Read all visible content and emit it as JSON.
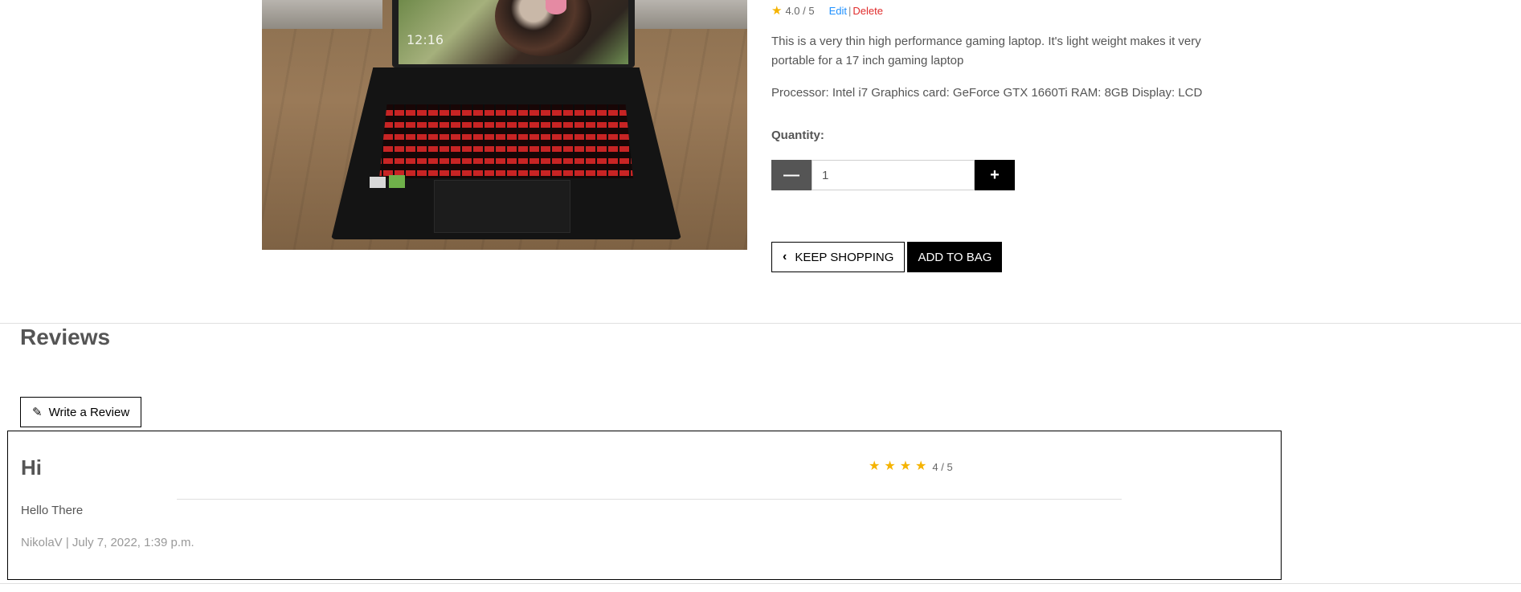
{
  "product": {
    "rating_text": "4.0 / 5",
    "edit_label": "Edit",
    "separator": "|",
    "delete_label": "Delete",
    "description": "This is a very thin high performance gaming laptop. It's light weight makes it very portable for a 17 inch gaming laptop",
    "specs": "Processor: Intel i7 Graphics card: GeForce GTX 1660Ti RAM: 8GB Display: LCD",
    "quantity_label": "Quantity:",
    "quantity_value": "1",
    "keep_shopping_label": "KEEP SHOPPING",
    "add_to_bag_label": "ADD TO BAG",
    "image_lock_time": "12:16",
    "star_color": "#f5b301"
  },
  "reviews": {
    "heading": "Reviews",
    "write_review_label": "Write a Review",
    "items": [
      {
        "title": "Hi",
        "stars": 4,
        "rating_text": "4 / 5",
        "body": "Hello There",
        "meta": "NikolaV | July 7, 2022, 1:39 p.m."
      }
    ]
  }
}
